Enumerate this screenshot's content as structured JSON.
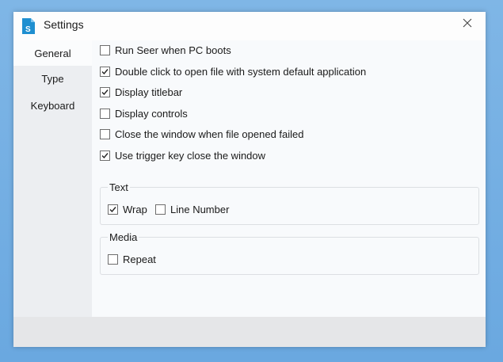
{
  "window": {
    "title": "Settings",
    "app_icon": "seer-logo-icon",
    "close_icon": "close-icon"
  },
  "sidebar": {
    "items": [
      {
        "label": "General",
        "active": true
      },
      {
        "label": "Type",
        "active": false
      },
      {
        "label": "Keyboard",
        "active": false
      }
    ]
  },
  "general": {
    "options": [
      {
        "label": "Run Seer when PC boots",
        "checked": false
      },
      {
        "label": "Double click to open file with system default application",
        "checked": true
      },
      {
        "label": "Display titlebar",
        "checked": true
      },
      {
        "label": "Display controls",
        "checked": false
      },
      {
        "label": "Close the window when file opened failed",
        "checked": false
      },
      {
        "label": "Use trigger key close the window",
        "checked": true
      }
    ],
    "text_group": {
      "title": "Text",
      "wrap": {
        "label": "Wrap",
        "checked": true
      },
      "line_number": {
        "label": "Line Number",
        "checked": false
      }
    },
    "media_group": {
      "title": "Media",
      "repeat": {
        "label": "Repeat",
        "checked": false
      }
    }
  },
  "colors": {
    "accent": "#1f8fd0",
    "sidebar_bg": "#eceef1",
    "footer_bg": "#e5e6e8"
  }
}
